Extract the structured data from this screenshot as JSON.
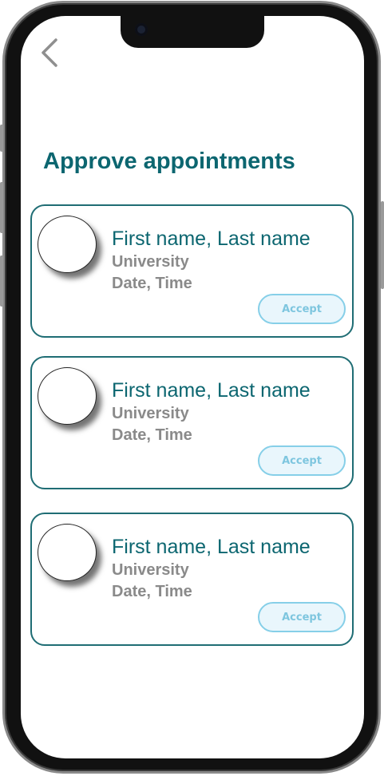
{
  "header": {
    "title": "Approve appointments",
    "back_icon": "chevron-left-icon"
  },
  "appointments": [
    {
      "name": "First name, Last name",
      "university": "University",
      "datetime": "Date, Time",
      "accept_label": "Accept"
    },
    {
      "name": "First name, Last name",
      "university": "University",
      "datetime": "Date, Time",
      "accept_label": "Accept"
    },
    {
      "name": "First name, Last name",
      "university": "University",
      "datetime": "Date, Time",
      "accept_label": "Accept"
    }
  ],
  "colors": {
    "accent": "#0c6670",
    "card_border": "#1f6d74",
    "muted_text": "#8a8a8a",
    "button_border": "#86cfe8",
    "button_fill": "#e9f6fc",
    "button_text": "#7ec6df"
  }
}
